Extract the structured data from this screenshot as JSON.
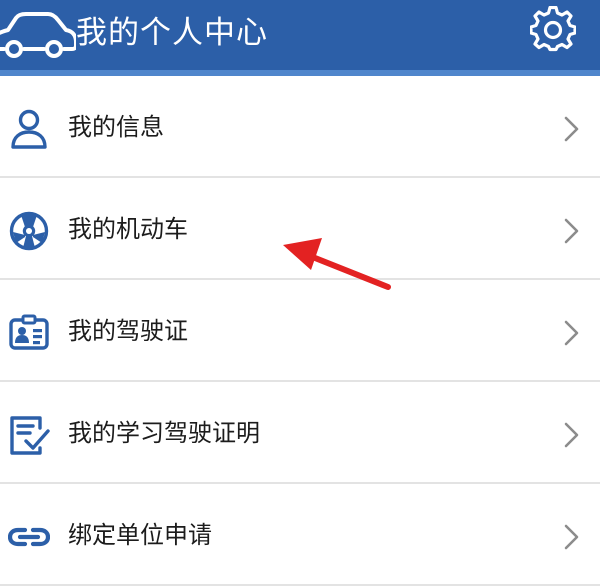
{
  "header": {
    "title": "我的个人中心",
    "car_icon": "car-outline-icon",
    "settings_icon": "gear-icon",
    "background_color": "#2c5fa8"
  },
  "menu": {
    "items": [
      {
        "label": "我的信息",
        "icon": "person-icon"
      },
      {
        "label": "我的机动车",
        "icon": "steering-wheel-icon"
      },
      {
        "label": "我的驾驶证",
        "icon": "id-card-icon"
      },
      {
        "label": "我的学习驾驶证明",
        "icon": "checklist-icon"
      },
      {
        "label": "绑定单位申请",
        "icon": "link-icon"
      }
    ],
    "chevron_icon": "chevron-right-icon",
    "icon_color": "#2c5fa8"
  },
  "annotation": {
    "type": "red-arrow-pointer",
    "color": "#e32222"
  }
}
